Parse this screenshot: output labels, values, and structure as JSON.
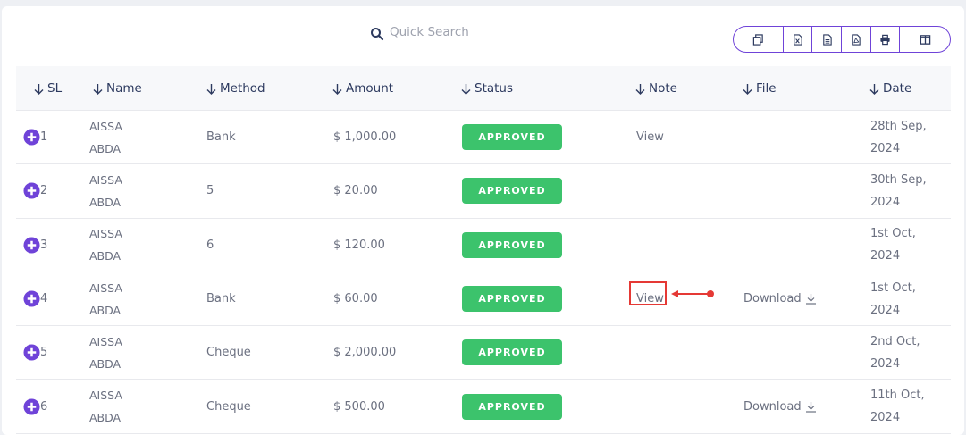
{
  "search": {
    "placeholder": "Quick Search"
  },
  "export_buttons": [
    {
      "name": "copy-button",
      "icon": "copy-icon"
    },
    {
      "name": "excel-button",
      "icon": "excel-icon"
    },
    {
      "name": "csv-button",
      "icon": "csv-icon"
    },
    {
      "name": "pdf-button",
      "icon": "pdf-icon"
    },
    {
      "name": "print-button",
      "icon": "print-icon"
    },
    {
      "name": "columns-button",
      "icon": "columns-icon"
    }
  ],
  "columns": [
    "SL",
    "Name",
    "Method",
    "Amount",
    "Status",
    "Note",
    "File",
    "Date"
  ],
  "rows": [
    {
      "sl": "1",
      "name_first": "AISSA",
      "name_last": "ABDA",
      "method": "Bank",
      "amount": "$ 1,000.00",
      "status": "APPROVED",
      "note": "View",
      "file": "",
      "date_line1": "28th Sep,",
      "date_line2": "2024"
    },
    {
      "sl": "2",
      "name_first": "AISSA",
      "name_last": "ABDA",
      "method": "5",
      "amount": "$ 20.00",
      "status": "APPROVED",
      "note": "",
      "file": "",
      "date_line1": "30th Sep,",
      "date_line2": "2024"
    },
    {
      "sl": "3",
      "name_first": "AISSA",
      "name_last": "ABDA",
      "method": "6",
      "amount": "$ 120.00",
      "status": "APPROVED",
      "note": "",
      "file": "",
      "date_line1": "1st Oct,",
      "date_line2": "2024"
    },
    {
      "sl": "4",
      "name_first": "AISSA",
      "name_last": "ABDA",
      "method": "Bank",
      "amount": "$ 60.00",
      "status": "APPROVED",
      "note": "View",
      "file": "Download",
      "date_line1": "1st Oct,",
      "date_line2": "2024"
    },
    {
      "sl": "5",
      "name_first": "AISSA",
      "name_last": "ABDA",
      "method": "Cheque",
      "amount": "$ 2,000.00",
      "status": "APPROVED",
      "note": "",
      "file": "",
      "date_line1": "2nd Oct,",
      "date_line2": "2024"
    },
    {
      "sl": "6",
      "name_first": "AISSA",
      "name_last": "ABDA",
      "method": "Cheque",
      "amount": "$ 500.00",
      "status": "APPROVED",
      "note": "",
      "file": "Download",
      "date_line1": "11th Oct,",
      "date_line2": "2024"
    }
  ],
  "colors": {
    "accent": "#6f43d8",
    "approved": "#3cc36c",
    "annotation": "#e53935",
    "header_text": "#2d3a5f"
  }
}
